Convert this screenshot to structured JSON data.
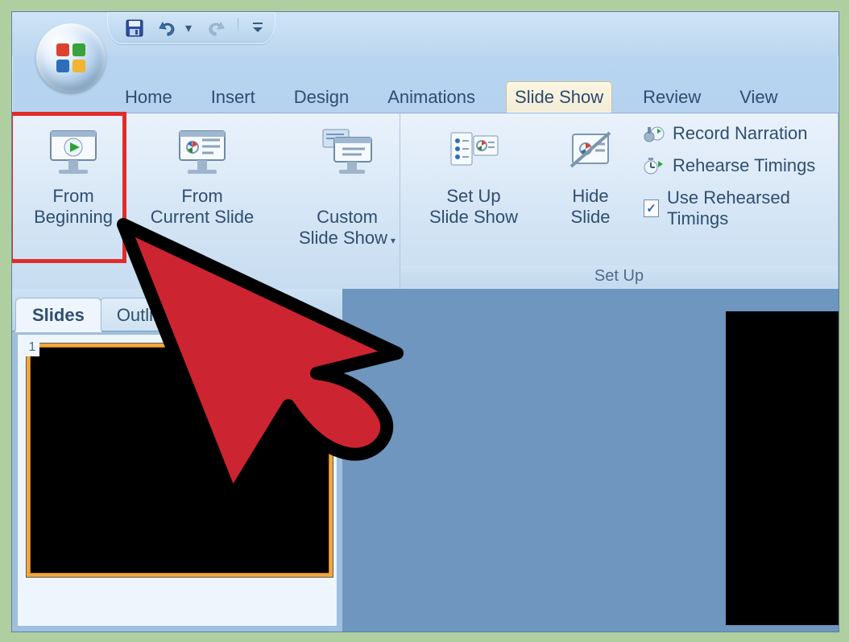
{
  "qat": {
    "save_name": "save-icon",
    "undo_name": "undo-icon",
    "redo_name": "redo-icon",
    "customize_name": "customize-qat-icon"
  },
  "tabs": {
    "home": "Home",
    "insert": "Insert",
    "design": "Design",
    "animations": "Animations",
    "slide_show": "Slide Show",
    "review": "Review",
    "view": "View"
  },
  "ribbon": {
    "from_beginning": "From\nBeginning",
    "from_current": "From\nCurrent Slide",
    "custom_show": "Custom\nSlide Show",
    "setup_show": "Set Up\nSlide Show",
    "hide_slide": "Hide\nSlide",
    "record_narration": "Record Narration",
    "rehearse_timings": "Rehearse Timings",
    "use_rehearsed": "Use Rehearsed Timings",
    "use_rehearsed_checked": "✓",
    "group_setup": "Set Up"
  },
  "sidebar": {
    "tab_slides": "Slides",
    "tab_outline": "Outline",
    "thumb1_num": "1"
  }
}
